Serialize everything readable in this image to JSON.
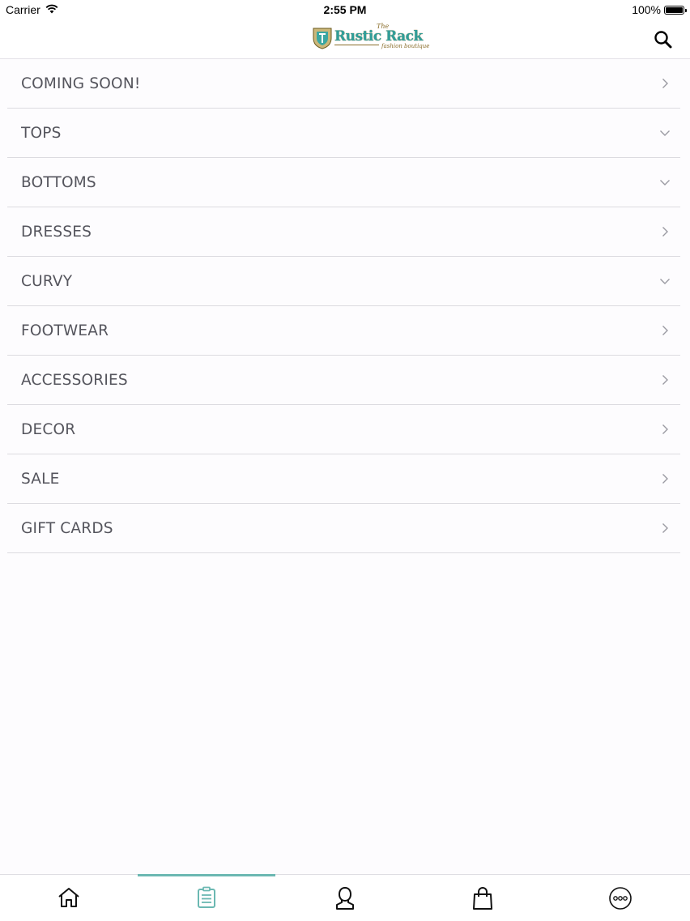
{
  "status_bar": {
    "carrier": "Carrier",
    "time": "2:55 PM",
    "battery": "100%"
  },
  "header": {
    "logo": {
      "the": "The",
      "brand": "Rustic Rack",
      "tagline": "fashion boutique"
    },
    "search_icon": "search-icon"
  },
  "menu": {
    "items": [
      {
        "label": "COMING SOON!",
        "chevron": "chevron-right-icon"
      },
      {
        "label": "TOPS",
        "chevron": "chevron-down-icon"
      },
      {
        "label": "BOTTOMS",
        "chevron": "chevron-down-icon"
      },
      {
        "label": "DRESSES",
        "chevron": "chevron-right-icon"
      },
      {
        "label": "CURVY",
        "chevron": "chevron-down-icon"
      },
      {
        "label": "FOOTWEAR",
        "chevron": "chevron-right-icon"
      },
      {
        "label": "ACCESSORIES",
        "chevron": "chevron-right-icon"
      },
      {
        "label": "DECOR",
        "chevron": "chevron-right-icon"
      },
      {
        "label": "SALE",
        "chevron": "chevron-right-icon"
      },
      {
        "label": "GIFT CARDS",
        "chevron": "chevron-right-icon"
      }
    ]
  },
  "tab_bar": {
    "tabs": [
      {
        "icon": "home-icon",
        "active": false
      },
      {
        "icon": "catalog-icon",
        "active": true
      },
      {
        "icon": "account-icon",
        "active": false
      },
      {
        "icon": "shopping-bag-icon",
        "active": false
      },
      {
        "icon": "more-icon",
        "active": false
      }
    ],
    "accent_color": "#6bb8b2"
  }
}
